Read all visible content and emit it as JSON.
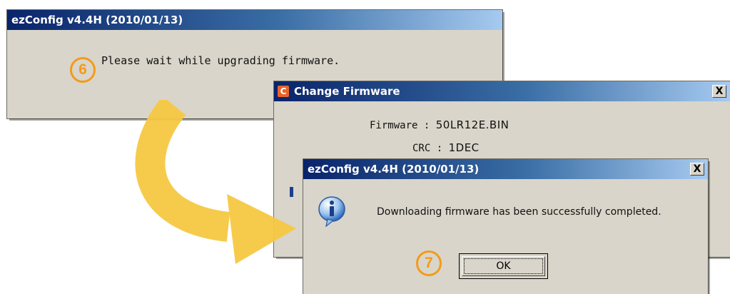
{
  "colors": {
    "titlebar_start": "#0a246a",
    "titlebar_end": "#a6caf0",
    "window_bg": "#d9d5ca",
    "step_badge": "#f39b1a",
    "arrow": "#f6c842"
  },
  "window1": {
    "title": "ezConfig v4.4H (2010/01/13)",
    "step_badge": "6",
    "message": "Please wait while upgrading firmware."
  },
  "window2": {
    "title": "Change Firmware",
    "icon": "app-icon",
    "close_label": "X",
    "firmware_label": "Firmware :",
    "firmware_value": "50LR12E.BIN",
    "crc_label": "CRC :",
    "crc_value": "1DEC"
  },
  "window3": {
    "title": "ezConfig v4.4H (2010/01/13)",
    "close_label": "X",
    "icon": "info-icon",
    "message": "Downloading firmware has been successfully completed.",
    "step_badge": "7",
    "ok_label": "OK"
  }
}
